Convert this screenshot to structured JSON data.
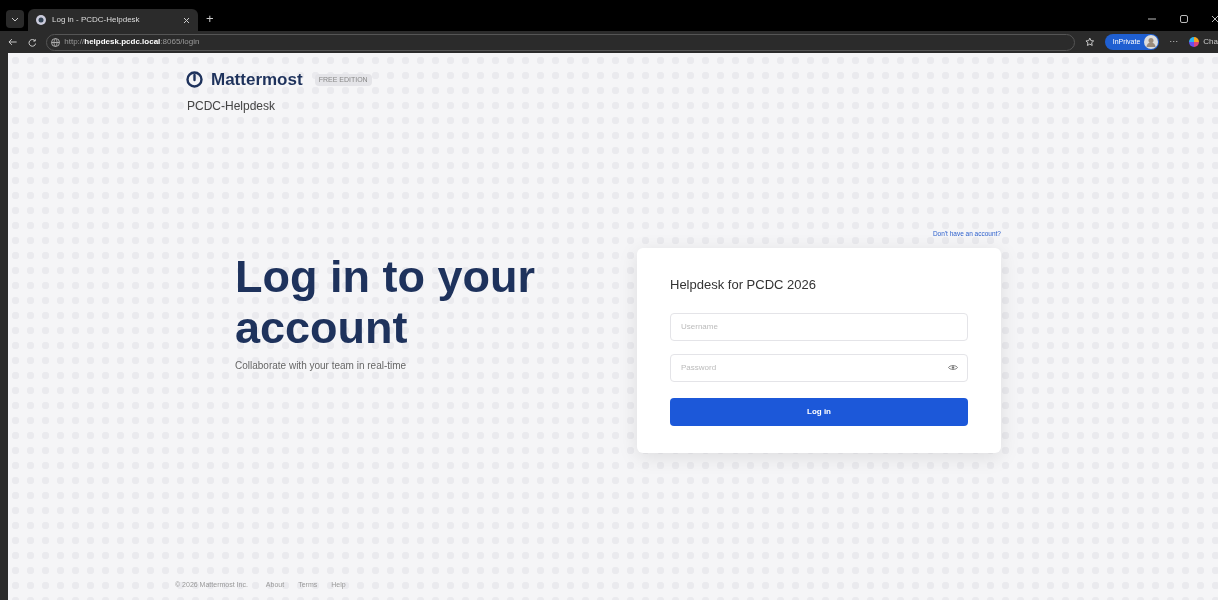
{
  "browser": {
    "tab_title": "Log in - PCDC-Helpdesk",
    "new_tab": "+",
    "url": "http://**helpdesk.pcdc.local**:8065/login",
    "profile_badge": "InPrivate",
    "more": "···",
    "copilot_label": "Cha"
  },
  "header": {
    "brand": "Mattermost",
    "edition": "FREE EDITION",
    "site_name": "PCDC-Helpdesk"
  },
  "signup_link": "Don't have an account?",
  "hero": {
    "title": "Log in to your account",
    "subtitle": "Collaborate with your team in real-time"
  },
  "login_card": {
    "title": "Helpdesk for PCDC 2026",
    "username": {
      "placeholder": "Username"
    },
    "password": {
      "placeholder": "Password"
    },
    "submit": "Log in"
  },
  "footer": {
    "copyright": "© 2026 Mattermost Inc.",
    "links": [
      "About",
      "Terms",
      "Help"
    ]
  }
}
